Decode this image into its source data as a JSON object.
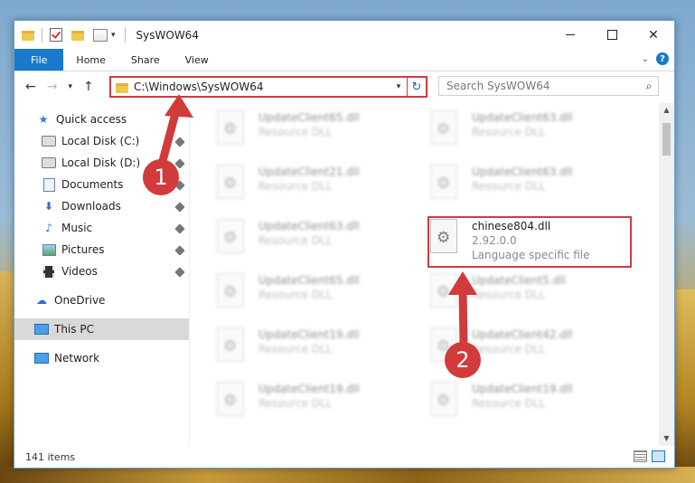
{
  "window": {
    "title": "SysWOW64",
    "controls": {
      "minimize": "",
      "maximize": "",
      "close": "✕"
    }
  },
  "ribbon": {
    "tabs": [
      "File",
      "Home",
      "Share",
      "View"
    ]
  },
  "address": {
    "path": "C:\\Windows\\SysWOW64",
    "search_placeholder": "Search SysWOW64"
  },
  "nav_pane": {
    "items": [
      {
        "label": "Quick access",
        "icon": "star-icon"
      },
      {
        "label": "Local Disk (C:)",
        "icon": "disk-icon"
      },
      {
        "label": "Local Disk (D:)",
        "icon": "disk-icon"
      },
      {
        "label": "Documents",
        "icon": "doc-icon"
      },
      {
        "label": "Downloads",
        "icon": "download-icon"
      },
      {
        "label": "Music",
        "icon": "music-icon"
      },
      {
        "label": "Pictures",
        "icon": "pictures-icon"
      },
      {
        "label": "Videos",
        "icon": "video-icon"
      },
      {
        "label": "OneDrive",
        "icon": "cloud-icon"
      },
      {
        "label": "This PC",
        "icon": "pc-icon"
      },
      {
        "label": "Network",
        "icon": "network-icon"
      }
    ]
  },
  "files": {
    "blurred": [
      {
        "name": "UpdateClient65.dll",
        "type": "Resource DLL"
      },
      {
        "name": "UpdateClient63.dll",
        "type": "Resource DLL"
      },
      {
        "name": "UpdateClient21.dll",
        "type": "Resource DLL"
      },
      {
        "name": "UpdateClient63.dll",
        "type": "Resource DLL"
      },
      {
        "name": "UpdateClient63.dll",
        "type": "Resource DLL"
      },
      {
        "name": "UpdateClient65.dll",
        "type": "Resource DLL"
      },
      {
        "name": "UpdateClient5.dll",
        "type": "Resource DLL"
      },
      {
        "name": "UpdateClient19.dll",
        "type": "Resource DLL"
      },
      {
        "name": "UpdateClient42.dll",
        "type": "Resource DLL"
      },
      {
        "name": "UpdateClient19.dll",
        "type": "Resource DLL"
      },
      {
        "name": "UpdateClient19.dll",
        "type": "Resource DLL"
      }
    ],
    "highlighted": {
      "name": "chinese804.dll",
      "version": "2.92.0.0",
      "type": "Language specific file"
    }
  },
  "status": {
    "item_count": "141 items"
  },
  "annotations": {
    "step1": "1",
    "step2": "2"
  },
  "colors": {
    "accent": "#1979ca",
    "annotation": "#d23b3b"
  }
}
